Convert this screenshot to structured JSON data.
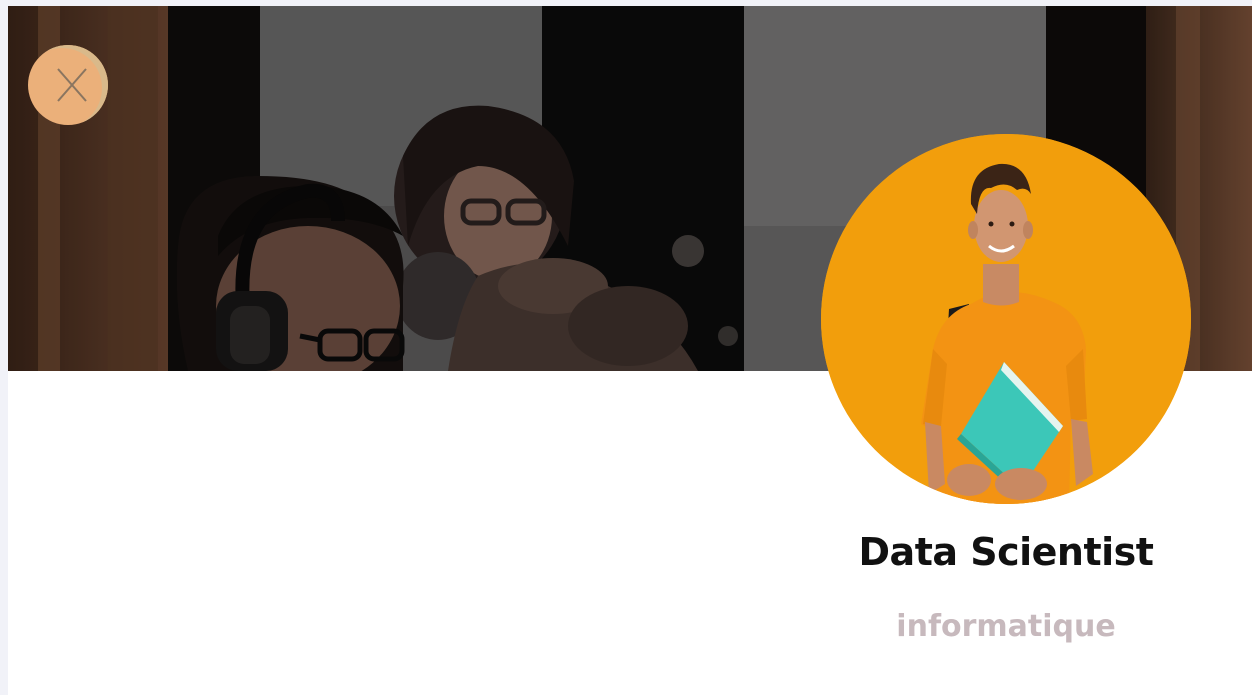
{
  "profile": {
    "title": "Data Scientist",
    "category": "informatique"
  },
  "icons": {
    "close": "close-icon"
  },
  "colors": {
    "page_background": "#f1f2f8",
    "card_background": "#ffffff",
    "close_button": "#ebb07a",
    "avatar_background": "#f29e0c",
    "title_text": "#111111",
    "category_text": "#c7b9bd"
  }
}
